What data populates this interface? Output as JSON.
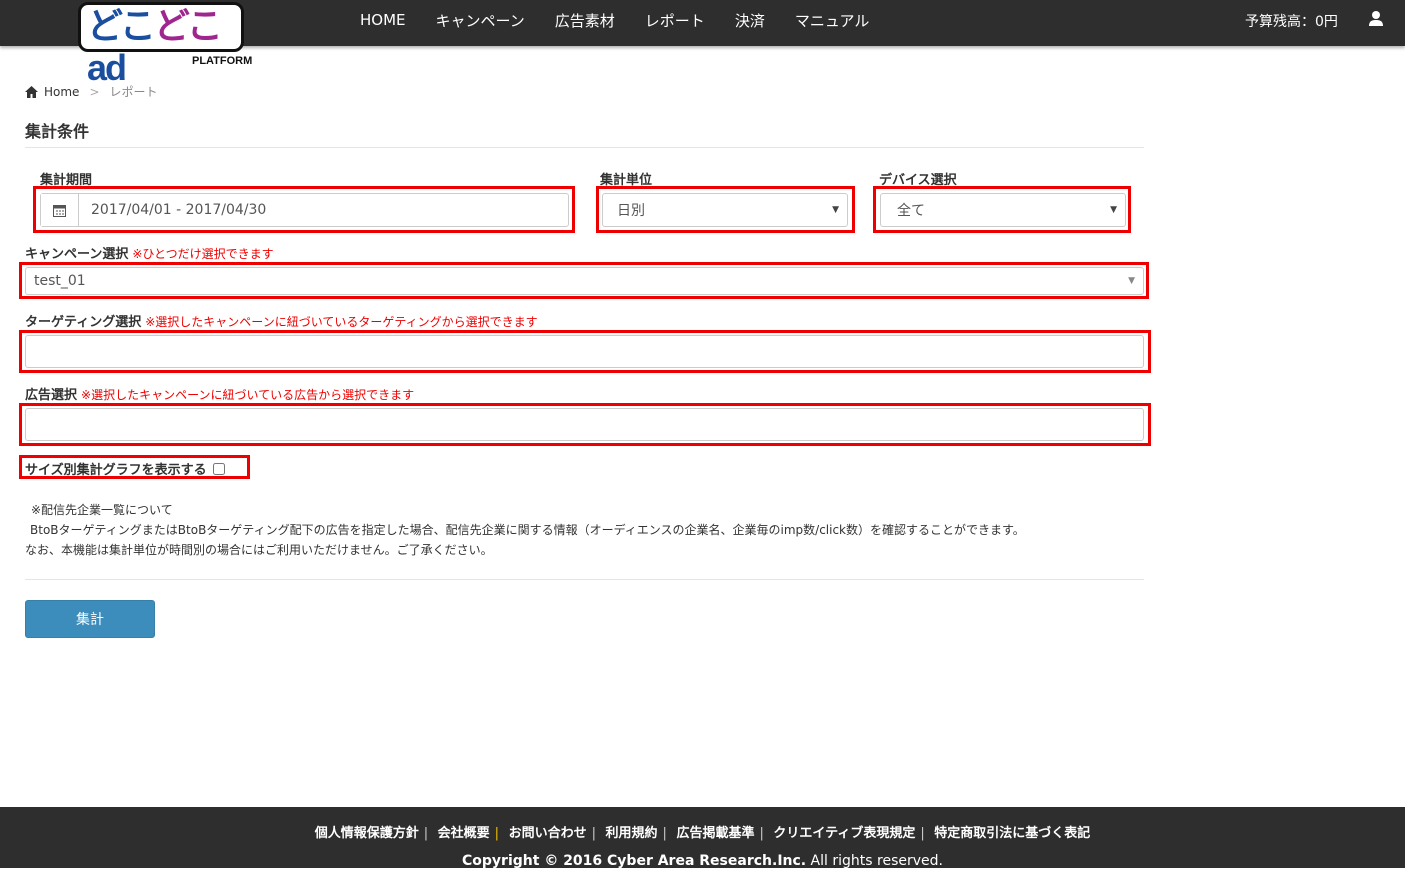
{
  "header": {
    "logo_text": "どこどこad",
    "logo_sub": "PLATFORM",
    "nav": [
      "HOME",
      "キャンペーン",
      "広告素材",
      "レポート",
      "決済",
      "マニュアル"
    ],
    "budget": "予算残高：0円"
  },
  "breadcrumb": {
    "home": "Home",
    "separator": ">",
    "current": "レポート"
  },
  "section_title": "集計条件",
  "form": {
    "period_label": "集計期間",
    "period_value": "2017/04/01 - 2017/04/30",
    "unit_label": "集計単位",
    "unit_value": "日別",
    "device_label": "デバイス選択",
    "device_value": "全て",
    "campaign_label": "キャンペーン選択",
    "campaign_note": "※ひとつだけ選択できます",
    "campaign_value": "test_01",
    "targeting_label": "ターゲティング選択",
    "targeting_note": "※選択したキャンペーンに紐づいているターゲティングから選択できます",
    "targeting_value": "",
    "ad_label": "広告選択",
    "ad_note": "※選択したキャンペーンに紐づいている広告から選択できます",
    "ad_value": "",
    "size_graph_label": "サイズ別集計グラフを表示する",
    "size_graph_checked": false
  },
  "info": {
    "line1": "※配信先企業一覧について",
    "line2": "BtoBターゲティングまたはBtoBターゲティング配下の広告を指定した場合、配信先企業に関する情報（オーディエンスの企業名、企業毎のimp数/click数）を確認することができます。",
    "line3": "なお、本機能は集計単位が時間別の場合にはご利用いただけません。ご了承ください。"
  },
  "submit_label": "集計",
  "footer": {
    "links": [
      "個人情報保護方針",
      "会社概要",
      "お問い合わせ",
      "利用規約",
      "広告掲載基準",
      "クリエイティブ表現規定",
      "特定商取引法に基づく表記"
    ],
    "separator": "|",
    "copyright_bold": "Copyright © 2016 Cyber Area Research.Inc.",
    "copyright_rest": " All rights reserved."
  }
}
